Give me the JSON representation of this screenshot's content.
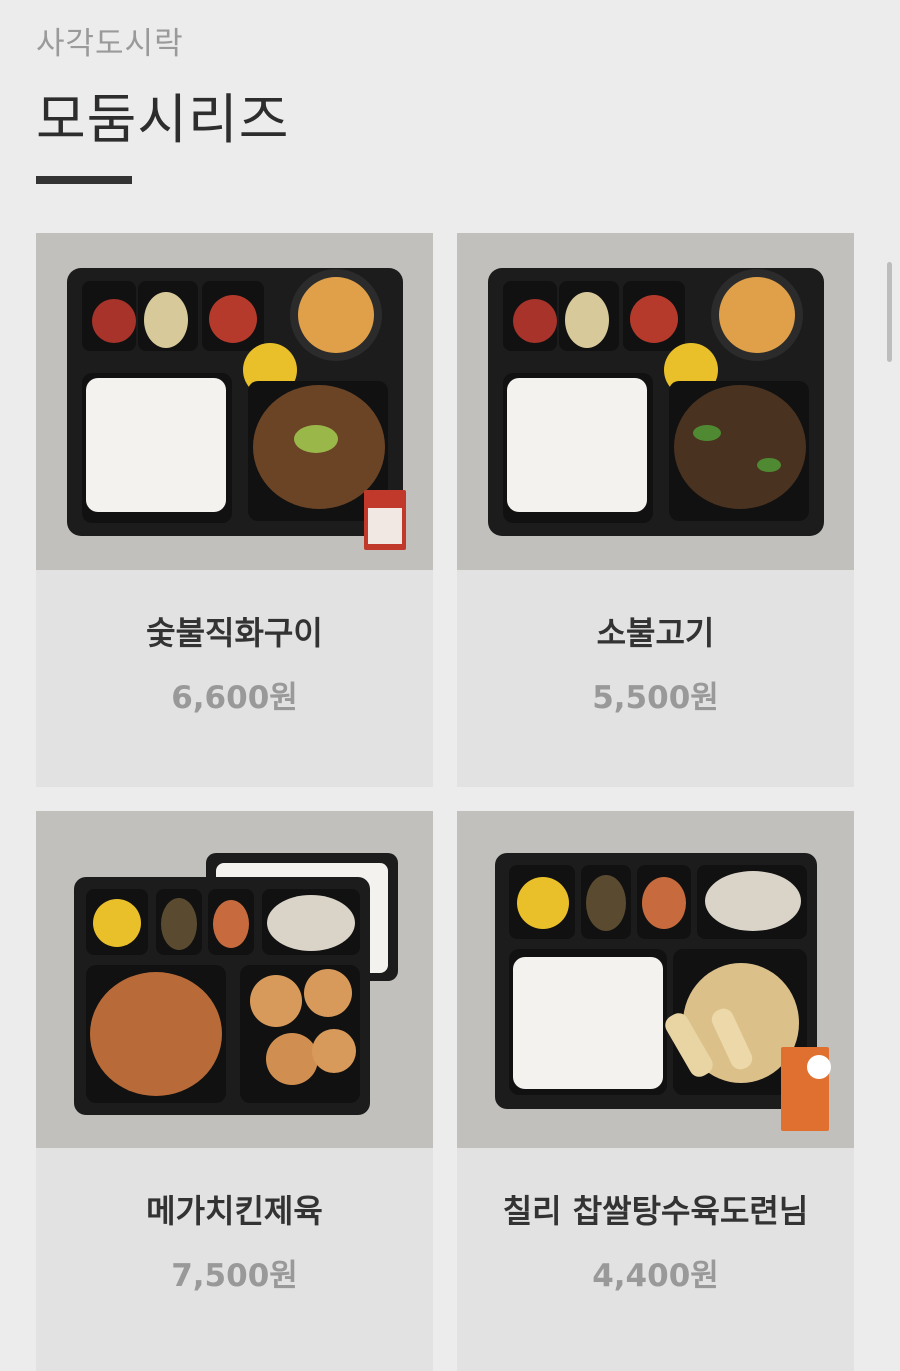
{
  "header": {
    "category": "사각도시락",
    "title": "모둠시리즈"
  },
  "products": [
    {
      "name": "숯불직화구이",
      "price": "6,600원",
      "image": "bento-grilled-pork-photo"
    },
    {
      "name": "소불고기",
      "price": "5,500원",
      "image": "bento-beef-bulgogi-photo"
    },
    {
      "name": "메가치킨제육",
      "price": "7,500원",
      "image": "bento-chicken-jeyuk-photo"
    },
    {
      "name": "칠리 찹쌀탕수육도련님",
      "price": "4,400원",
      "image": "bento-sweet-sour-pork-photo"
    }
  ],
  "colors": {
    "background": "#edecec",
    "card": "#e3e2e3",
    "photo_backdrop": "#c2c0bc",
    "tray": "#1c1c1c",
    "accent_bar": "#333333"
  }
}
